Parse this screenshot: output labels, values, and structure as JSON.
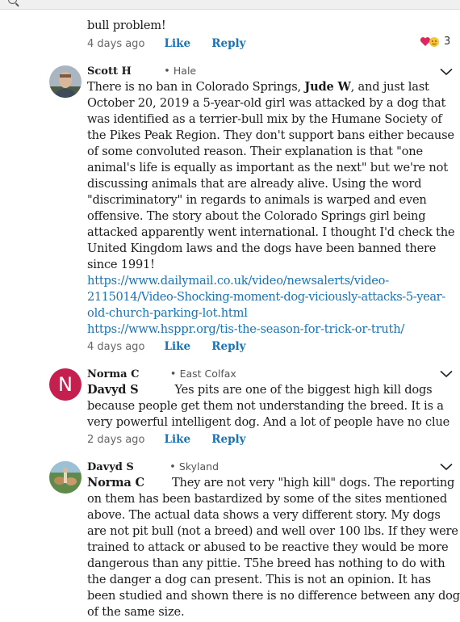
{
  "comments": [
    {
      "text_tail": "bull problem!",
      "time": "4 days ago",
      "like_label": "Like",
      "reply_label": "Reply",
      "reaction_count": "3"
    },
    {
      "author": "Scott H",
      "location": "Hale",
      "text_prefix": "There is no ban in Colorado Springs, ",
      "mention": "Jude W",
      "body_lines": [
        ", and just last",
        "October 20, 2019 a 5-year-old girl was attacked by a dog that",
        "was identified as a terrier-bull mix by the Humane Society of",
        "the Pikes Peak Region. They don't support bans either because",
        "of some convoluted reason. Their explanation is that \"one",
        "animal's life is equally as important as the next\" but we're not",
        "discussing animals that are already alive. Using the word",
        "\"discriminatory\" in regards to animals is warped and even",
        "offensive. The story about the Colorado Springs girl being",
        "attacked apparently went international. I thought I'd check the",
        "United Kingdom laws and the dogs have been banned there",
        "since 1991!"
      ],
      "link1_lines": [
        "https://www.dailymail.co.uk/video/newsalerts/video-",
        "2115014/Video-Shocking-moment-dog-viciously-attacks-5-year-",
        "old-church-parking-lot.html"
      ],
      "link2": "https://www.hsppr.org/tis-the-season-for-trick-or-truth/",
      "time": "4 days ago",
      "like_label": "Like",
      "reply_label": "Reply"
    },
    {
      "author": "Norma C",
      "location": "East Colfax",
      "avatar_letter": "N",
      "mention": "Davyd S",
      "body_lines": [
        "Yes pits are one of the biggest high kill dogs",
        "because people get them not understanding the breed.  It is a",
        "very powerful intelligent dog. And a lot of people have no clue"
      ],
      "time": "2 days ago",
      "like_label": "Like",
      "reply_label": "Reply"
    },
    {
      "author": "Davyd S",
      "location": "Skyland",
      "mention": "Norma C",
      "body_lines": [
        "They are not very \"high kill\" dogs.  The reporting",
        "on them has been bastardized by some of the sites mentioned",
        "above.  The actual data shows a very different story.  My dogs",
        "are not pit bull (not a breed) and well over 100 lbs.  If they were",
        "trained to attack or abused to be reactive they would be more",
        "dangerous than any pittie.  T5he breed has nothing to do with",
        "the danger a dog can present.  This is not an opinion.  It has",
        "been studied and shown there is no difference between any dog",
        "of the same size."
      ]
    }
  ],
  "colors": {
    "link": "#1a73b6",
    "avatar_n": "#c51f4f",
    "heart": "#e0245e"
  },
  "icons": [
    "search-icon",
    "chevron-down-icon",
    "heart-icon",
    "smile-icon"
  ]
}
